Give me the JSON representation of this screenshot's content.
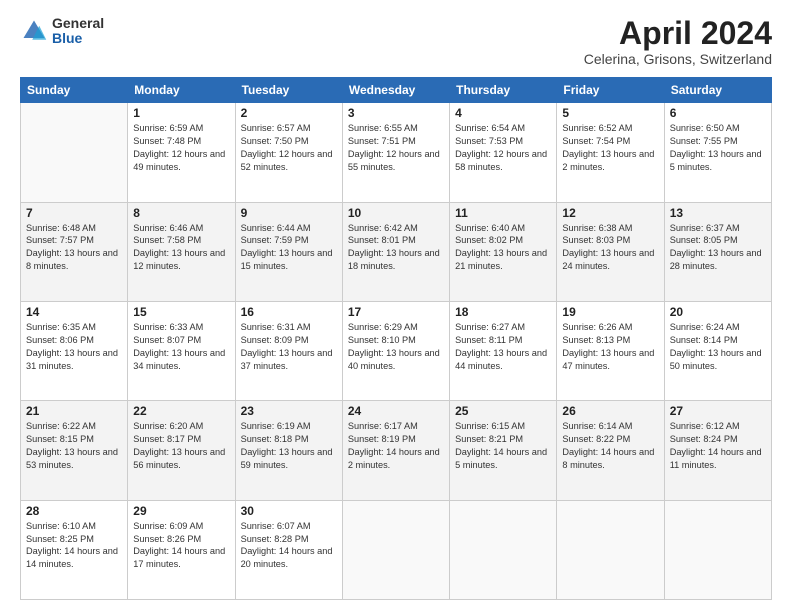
{
  "header": {
    "logo_general": "General",
    "logo_blue": "Blue",
    "month_title": "April 2024",
    "location": "Celerina, Grisons, Switzerland"
  },
  "weekdays": [
    "Sunday",
    "Monday",
    "Tuesday",
    "Wednesday",
    "Thursday",
    "Friday",
    "Saturday"
  ],
  "weeks": [
    [
      {
        "day": null,
        "sunrise": null,
        "sunset": null,
        "daylight": null
      },
      {
        "day": "1",
        "sunrise": "Sunrise: 6:59 AM",
        "sunset": "Sunset: 7:48 PM",
        "daylight": "Daylight: 12 hours and 49 minutes."
      },
      {
        "day": "2",
        "sunrise": "Sunrise: 6:57 AM",
        "sunset": "Sunset: 7:50 PM",
        "daylight": "Daylight: 12 hours and 52 minutes."
      },
      {
        "day": "3",
        "sunrise": "Sunrise: 6:55 AM",
        "sunset": "Sunset: 7:51 PM",
        "daylight": "Daylight: 12 hours and 55 minutes."
      },
      {
        "day": "4",
        "sunrise": "Sunrise: 6:54 AM",
        "sunset": "Sunset: 7:53 PM",
        "daylight": "Daylight: 12 hours and 58 minutes."
      },
      {
        "day": "5",
        "sunrise": "Sunrise: 6:52 AM",
        "sunset": "Sunset: 7:54 PM",
        "daylight": "Daylight: 13 hours and 2 minutes."
      },
      {
        "day": "6",
        "sunrise": "Sunrise: 6:50 AM",
        "sunset": "Sunset: 7:55 PM",
        "daylight": "Daylight: 13 hours and 5 minutes."
      }
    ],
    [
      {
        "day": "7",
        "sunrise": "Sunrise: 6:48 AM",
        "sunset": "Sunset: 7:57 PM",
        "daylight": "Daylight: 13 hours and 8 minutes."
      },
      {
        "day": "8",
        "sunrise": "Sunrise: 6:46 AM",
        "sunset": "Sunset: 7:58 PM",
        "daylight": "Daylight: 13 hours and 12 minutes."
      },
      {
        "day": "9",
        "sunrise": "Sunrise: 6:44 AM",
        "sunset": "Sunset: 7:59 PM",
        "daylight": "Daylight: 13 hours and 15 minutes."
      },
      {
        "day": "10",
        "sunrise": "Sunrise: 6:42 AM",
        "sunset": "Sunset: 8:01 PM",
        "daylight": "Daylight: 13 hours and 18 minutes."
      },
      {
        "day": "11",
        "sunrise": "Sunrise: 6:40 AM",
        "sunset": "Sunset: 8:02 PM",
        "daylight": "Daylight: 13 hours and 21 minutes."
      },
      {
        "day": "12",
        "sunrise": "Sunrise: 6:38 AM",
        "sunset": "Sunset: 8:03 PM",
        "daylight": "Daylight: 13 hours and 24 minutes."
      },
      {
        "day": "13",
        "sunrise": "Sunrise: 6:37 AM",
        "sunset": "Sunset: 8:05 PM",
        "daylight": "Daylight: 13 hours and 28 minutes."
      }
    ],
    [
      {
        "day": "14",
        "sunrise": "Sunrise: 6:35 AM",
        "sunset": "Sunset: 8:06 PM",
        "daylight": "Daylight: 13 hours and 31 minutes."
      },
      {
        "day": "15",
        "sunrise": "Sunrise: 6:33 AM",
        "sunset": "Sunset: 8:07 PM",
        "daylight": "Daylight: 13 hours and 34 minutes."
      },
      {
        "day": "16",
        "sunrise": "Sunrise: 6:31 AM",
        "sunset": "Sunset: 8:09 PM",
        "daylight": "Daylight: 13 hours and 37 minutes."
      },
      {
        "day": "17",
        "sunrise": "Sunrise: 6:29 AM",
        "sunset": "Sunset: 8:10 PM",
        "daylight": "Daylight: 13 hours and 40 minutes."
      },
      {
        "day": "18",
        "sunrise": "Sunrise: 6:27 AM",
        "sunset": "Sunset: 8:11 PM",
        "daylight": "Daylight: 13 hours and 44 minutes."
      },
      {
        "day": "19",
        "sunrise": "Sunrise: 6:26 AM",
        "sunset": "Sunset: 8:13 PM",
        "daylight": "Daylight: 13 hours and 47 minutes."
      },
      {
        "day": "20",
        "sunrise": "Sunrise: 6:24 AM",
        "sunset": "Sunset: 8:14 PM",
        "daylight": "Daylight: 13 hours and 50 minutes."
      }
    ],
    [
      {
        "day": "21",
        "sunrise": "Sunrise: 6:22 AM",
        "sunset": "Sunset: 8:15 PM",
        "daylight": "Daylight: 13 hours and 53 minutes."
      },
      {
        "day": "22",
        "sunrise": "Sunrise: 6:20 AM",
        "sunset": "Sunset: 8:17 PM",
        "daylight": "Daylight: 13 hours and 56 minutes."
      },
      {
        "day": "23",
        "sunrise": "Sunrise: 6:19 AM",
        "sunset": "Sunset: 8:18 PM",
        "daylight": "Daylight: 13 hours and 59 minutes."
      },
      {
        "day": "24",
        "sunrise": "Sunrise: 6:17 AM",
        "sunset": "Sunset: 8:19 PM",
        "daylight": "Daylight: 14 hours and 2 minutes."
      },
      {
        "day": "25",
        "sunrise": "Sunrise: 6:15 AM",
        "sunset": "Sunset: 8:21 PM",
        "daylight": "Daylight: 14 hours and 5 minutes."
      },
      {
        "day": "26",
        "sunrise": "Sunrise: 6:14 AM",
        "sunset": "Sunset: 8:22 PM",
        "daylight": "Daylight: 14 hours and 8 minutes."
      },
      {
        "day": "27",
        "sunrise": "Sunrise: 6:12 AM",
        "sunset": "Sunset: 8:24 PM",
        "daylight": "Daylight: 14 hours and 11 minutes."
      }
    ],
    [
      {
        "day": "28",
        "sunrise": "Sunrise: 6:10 AM",
        "sunset": "Sunset: 8:25 PM",
        "daylight": "Daylight: 14 hours and 14 minutes."
      },
      {
        "day": "29",
        "sunrise": "Sunrise: 6:09 AM",
        "sunset": "Sunset: 8:26 PM",
        "daylight": "Daylight: 14 hours and 17 minutes."
      },
      {
        "day": "30",
        "sunrise": "Sunrise: 6:07 AM",
        "sunset": "Sunset: 8:28 PM",
        "daylight": "Daylight: 14 hours and 20 minutes."
      },
      {
        "day": null,
        "sunrise": null,
        "sunset": null,
        "daylight": null
      },
      {
        "day": null,
        "sunrise": null,
        "sunset": null,
        "daylight": null
      },
      {
        "day": null,
        "sunrise": null,
        "sunset": null,
        "daylight": null
      },
      {
        "day": null,
        "sunrise": null,
        "sunset": null,
        "daylight": null
      }
    ]
  ]
}
